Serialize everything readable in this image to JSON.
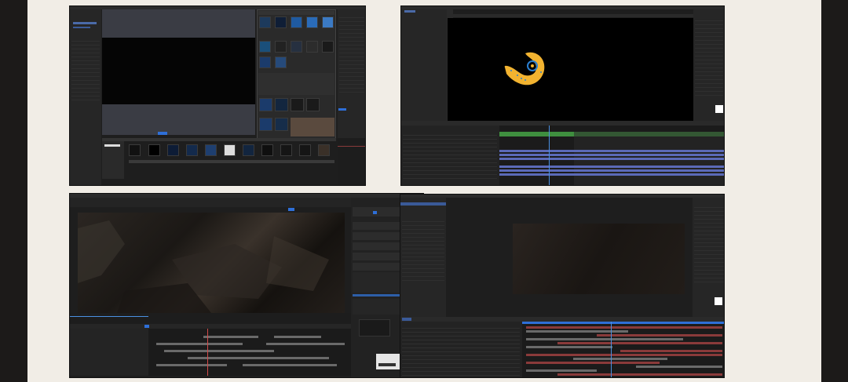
{
  "colors": {
    "page_background": "#f1ede6",
    "frame_background": "#1c1a19",
    "panel_dark": "#1e1e1e",
    "accent_blue": "#2e6fd8",
    "timeline_green": "#3f8f3f",
    "layer_blue": "#5b6ab8",
    "layer_gray": "#6a6a6a",
    "layer_red": "#8a3a3a",
    "logo_orange": "#f2b330"
  },
  "screenshots": [
    {
      "id": "effect-preset-browser",
      "description_icon": "particle-effect-thumbnails"
    },
    {
      "id": "logo-animation-timeline",
      "description_icon": "orange-swirl-logo"
    },
    {
      "id": "video-editor-scene",
      "description_icon": "dark-cave-footage"
    },
    {
      "id": "dark-composition-timeline",
      "description_icon": "multi-layer-timeline"
    }
  ]
}
